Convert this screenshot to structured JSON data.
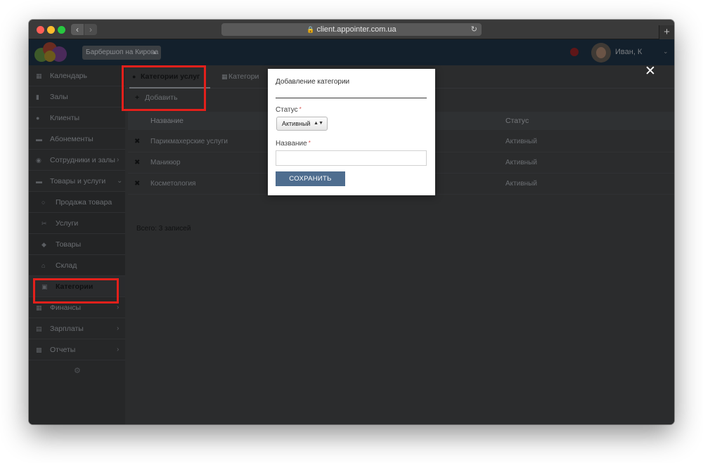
{
  "browser": {
    "url": "client.appointer.com.ua",
    "back_glyph": "‹",
    "forward_glyph": "›",
    "new_tab_glyph": "+"
  },
  "header": {
    "branch": "Барбершоп на Кирова",
    "username": "Иван, К"
  },
  "sidebar": {
    "items": [
      {
        "label": "Календарь",
        "icon": "calendar-icon"
      },
      {
        "label": "Залы",
        "icon": "bookmark-icon"
      },
      {
        "label": "Клиенты",
        "icon": "users-icon"
      },
      {
        "label": "Абонементы",
        "icon": "card-icon"
      },
      {
        "label": "Сотрудники и залы",
        "icon": "staff-icon"
      },
      {
        "label": "Товары и услуги",
        "icon": "goods-icon"
      },
      {
        "label": "Продажа товара",
        "icon": "sale-icon"
      },
      {
        "label": "Услуги",
        "icon": "scissors-icon"
      },
      {
        "label": "Товары",
        "icon": "product-icon"
      },
      {
        "label": "Склад",
        "icon": "warehouse-icon"
      },
      {
        "label": "Категории",
        "icon": "tags-icon"
      },
      {
        "label": "Финансы",
        "icon": "finance-icon"
      },
      {
        "label": "Зарплаты",
        "icon": "salary-icon"
      },
      {
        "label": "Отчеты",
        "icon": "chart-icon"
      }
    ]
  },
  "main": {
    "tabs": [
      {
        "label": "Категории услуг"
      },
      {
        "label": "Категори"
      }
    ],
    "add_label": "Добавить",
    "columns": {
      "name": "Название",
      "status": "Статус"
    },
    "rows": [
      {
        "name": "Парикмахерские услуги",
        "status": "Активный"
      },
      {
        "name": "Маникюр",
        "status": "Активный"
      },
      {
        "name": "Косметология",
        "status": "Активный"
      }
    ],
    "total": "Всего: 3 записей"
  },
  "modal": {
    "title": "Добавление категории",
    "status_label": "Статус",
    "status_value": "Активный",
    "name_label": "Название",
    "name_value": "",
    "required_mark": "*",
    "save_label": "СОХРАНИТЬ",
    "close_glyph": "✕"
  }
}
